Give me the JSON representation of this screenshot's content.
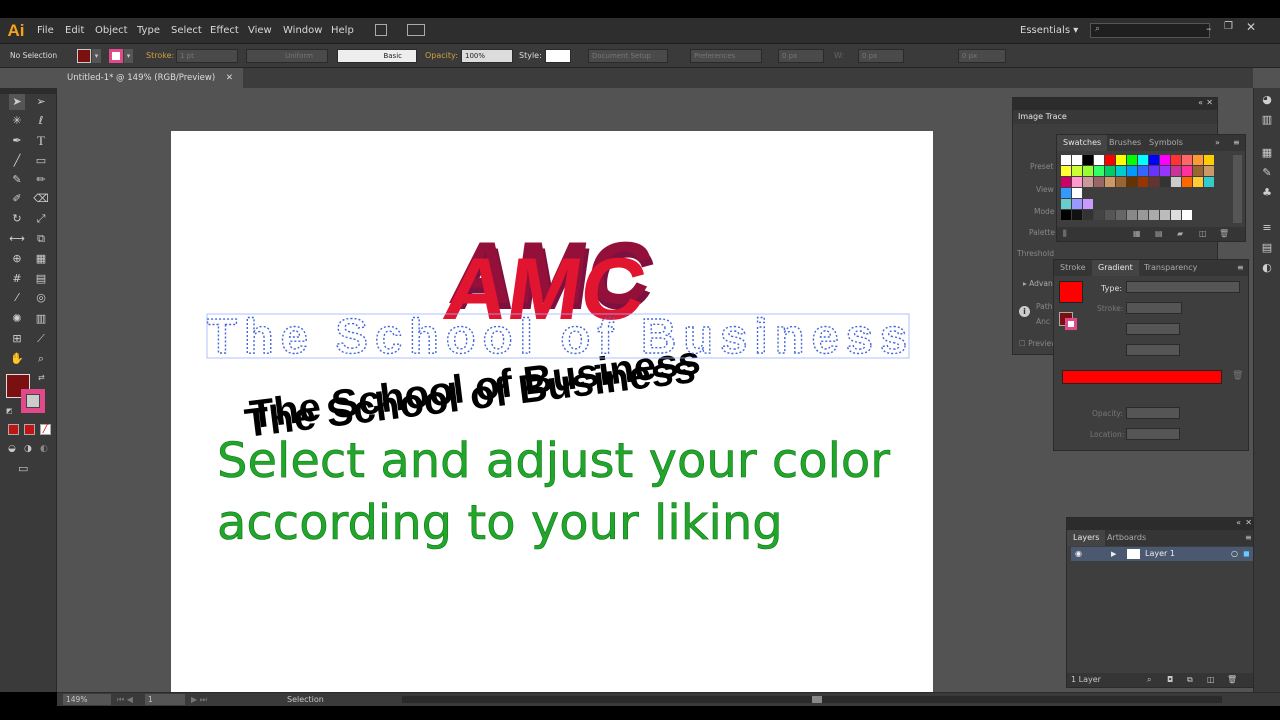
{
  "app": {
    "logo_text": "Ai"
  },
  "menu": [
    "File",
    "Edit",
    "Object",
    "Type",
    "Select",
    "Effect",
    "View",
    "Window",
    "Help"
  ],
  "workspace": {
    "name": "Essentials"
  },
  "control_bar": {
    "selection_label": "No Selection",
    "stroke_label": "Stroke:",
    "stroke_weight": "1 pt",
    "profile_label": "Uniform",
    "brush_label": "Basic",
    "opacity_label": "Opacity:",
    "opacity_value": "100%",
    "style_label": "Style:",
    "doc_setup": "Document Setup",
    "preferences": "Preferences",
    "x_value": "0 px",
    "w_label": "W:",
    "w_value": "0 px",
    "h_value": "0 px"
  },
  "document": {
    "tab_title": "Untitled-1* @ 149% (RGB/Preview)"
  },
  "artwork": {
    "amc": "AMC",
    "subtitle": "The School of Business",
    "caption_line1": "Select and adjust your color",
    "caption_line2": "according to your liking",
    "caption_color": "#22a52b",
    "amc_color": "#e21530"
  },
  "image_trace": {
    "title": "Image Trace",
    "labels": [
      "Preset",
      "View",
      "Mode",
      "Palette",
      "Threshold",
      "Advanced",
      "Path",
      "Anc",
      "Preview"
    ]
  },
  "swatches": {
    "tabs": [
      "Swatches",
      "Brushes",
      "Symbols"
    ]
  },
  "gradient": {
    "tabs": [
      "Stroke",
      "Gradient",
      "Transparency"
    ],
    "type_label": "Type:",
    "stroke_label": "Stroke:",
    "opacity_label": "Opacity:",
    "location_label": "Location:",
    "gradient_color": "#ff0000"
  },
  "layers": {
    "tabs": [
      "Layers",
      "Artboards"
    ],
    "layer_name": "Layer 1",
    "count": "1 Layer"
  },
  "status": {
    "zoom": "149%",
    "artboard_num": "1",
    "tool": "Selection"
  },
  "colors": {
    "accent_fill": "#7a1010",
    "accent_stroke": "#e04a8a"
  }
}
